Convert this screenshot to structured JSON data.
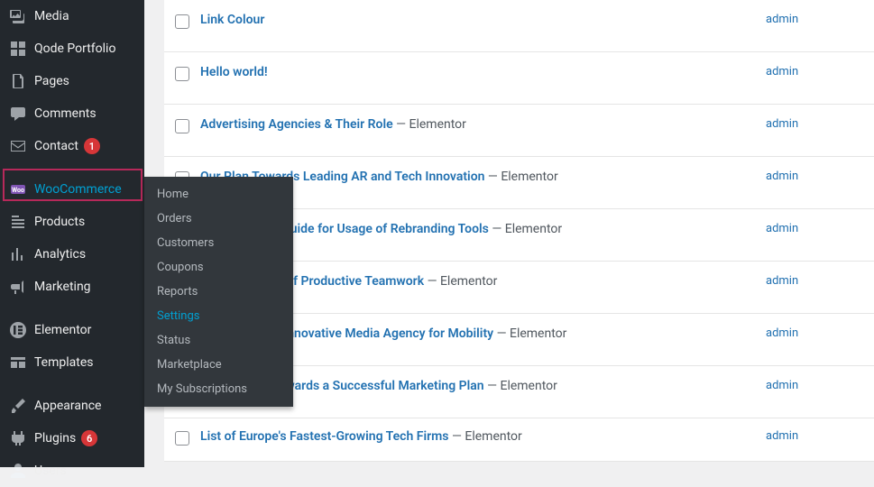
{
  "sidebar": {
    "items": [
      {
        "label": "Media"
      },
      {
        "label": "Qode Portfolio"
      },
      {
        "label": "Pages"
      },
      {
        "label": "Comments"
      },
      {
        "label": "Contact",
        "badge": "1"
      },
      {
        "label": "WooCommerce"
      },
      {
        "label": "Products"
      },
      {
        "label": "Analytics"
      },
      {
        "label": "Marketing"
      },
      {
        "label": "Elementor"
      },
      {
        "label": "Templates"
      },
      {
        "label": "Appearance"
      },
      {
        "label": "Plugins",
        "badge": "6"
      },
      {
        "label": "Users"
      }
    ]
  },
  "submenu": {
    "items": [
      {
        "label": "Home"
      },
      {
        "label": "Orders"
      },
      {
        "label": "Customers"
      },
      {
        "label": "Coupons"
      },
      {
        "label": "Reports"
      },
      {
        "label": "Settings"
      },
      {
        "label": "Status"
      },
      {
        "label": "Marketplace"
      },
      {
        "label": "My Subscriptions"
      }
    ]
  },
  "posts": {
    "rows": [
      {
        "title": "Link Colour",
        "builder": "",
        "author": "admin"
      },
      {
        "title": "Hello world!",
        "builder": "",
        "author": "admin"
      },
      {
        "title": "Advertising Agencies & Their Role",
        "builder": " — Elementor",
        "author": "admin"
      },
      {
        "title": "Our Plan Towards Leading AR and Tech Innovation",
        "builder": " — Elementor",
        "author": "admin"
      },
      {
        "title": "The Definitive Guide for Usage of Rebranding Tools",
        "builder": " — Elementor",
        "author": "admin"
      },
      {
        "title": "A Brief History of Productive Teamwork",
        "builder": " — Elementor",
        "author": "admin"
      },
      {
        "title": "Developing an Innovative Media Agency for Mobility",
        "builder": " — Elementor",
        "author": "admin"
      },
      {
        "title": "Three Steps Towards a Successful Marketing Plan",
        "builder": " — Elementor",
        "author": "admin"
      },
      {
        "title": "List of Europe's Fastest-Growing Tech Firms",
        "builder": " — Elementor",
        "author": "admin"
      }
    ]
  }
}
